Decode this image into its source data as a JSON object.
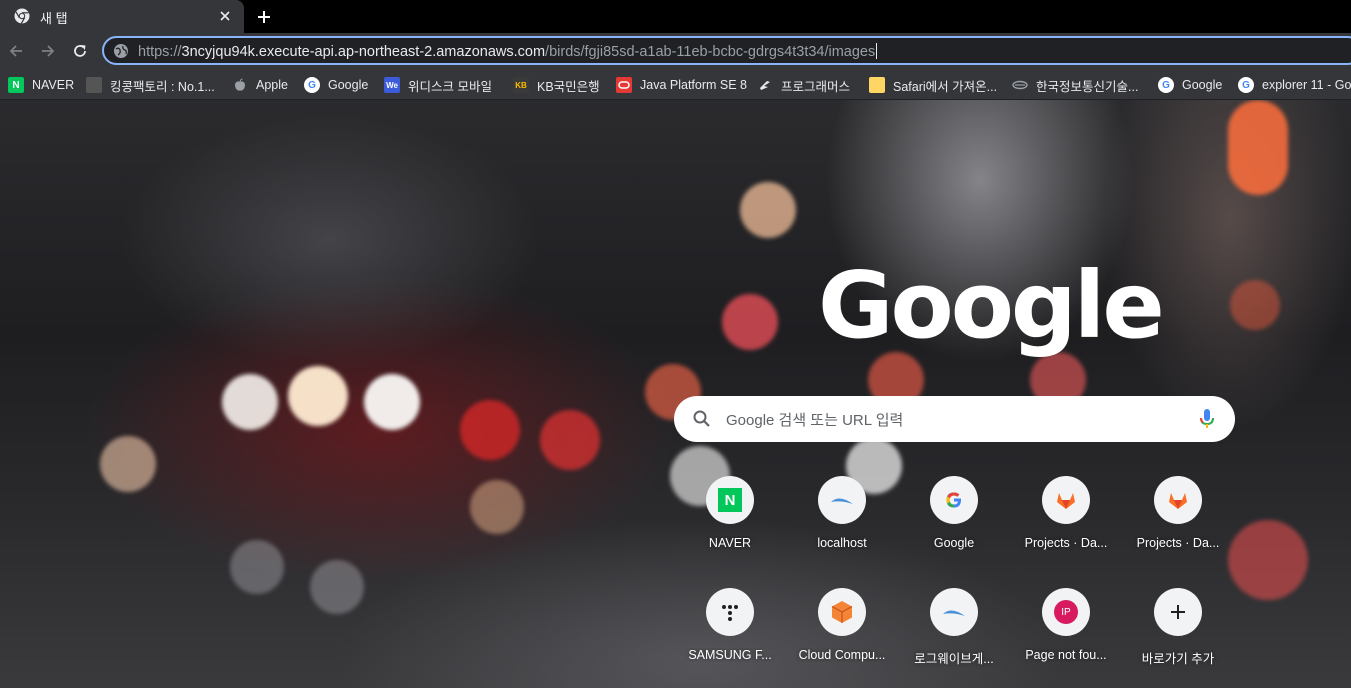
{
  "tab": {
    "title": "새 탭",
    "favicon": "chrome-icon"
  },
  "toolbar": {
    "back_icon": "back-arrow-icon",
    "forward_icon": "forward-arrow-icon",
    "reload_icon": "reload-icon",
    "url_scheme": "https://",
    "url_host": "3ncyjqu94k.execute-api.ap-northeast-2.amazonaws.com",
    "url_path": "/birds/fgji85sd-a1ab-11eb-bcbc-gdrgs4t3t34/images"
  },
  "bookmarks": [
    {
      "label": "NAVER",
      "icon": "naver-icon",
      "color": "#03c75a"
    },
    {
      "label": "킹콩팩토리 : No.1...",
      "icon": "kingkong-icon",
      "color": "#555555"
    },
    {
      "label": "Apple",
      "icon": "apple-icon",
      "color": "#9aa0a6"
    },
    {
      "label": "Google",
      "icon": "google-icon",
      "color": "#ffffff"
    },
    {
      "label": "위디스크 모바일",
      "icon": "wedisk-icon",
      "color": "#3b5bdb"
    },
    {
      "label": "KB국민은행",
      "icon": "kb-icon",
      "color": "#ffbc00"
    },
    {
      "label": "Java Platform SE 8",
      "icon": "oracle-icon",
      "color": "#e53935"
    },
    {
      "label": "프로그래머스",
      "icon": "programmers-icon",
      "color": "#ffffff"
    },
    {
      "label": "Safari에서 가져온...",
      "icon": "folder-icon",
      "color": "#fdd663"
    },
    {
      "label": "한국정보통신기술...",
      "icon": "tta-icon",
      "color": "#9aa0a6"
    },
    {
      "label": "Google",
      "icon": "google-icon",
      "color": "#ffffff"
    },
    {
      "label": "explorer 11 - Go",
      "icon": "google-icon",
      "color": "#ffffff"
    }
  ],
  "ntp": {
    "logo": "Google",
    "search_placeholder": "Google 검색 또는 URL 입력",
    "shortcuts": [
      {
        "label": "NAVER",
        "icon": "naver-icon"
      },
      {
        "label": "localhost",
        "icon": "wave-icon"
      },
      {
        "label": "Google",
        "icon": "google-g-icon"
      },
      {
        "label": "Projects · Da...",
        "icon": "gitlab-icon"
      },
      {
        "label": "Projects · Da...",
        "icon": "gitlab-icon"
      },
      {
        "label": "SAMSUNG F...",
        "icon": "samsung-dots-icon"
      },
      {
        "label": "Cloud Compu...",
        "icon": "aws-cube-icon"
      },
      {
        "label": "로그웨이브게...",
        "icon": "wave-icon"
      },
      {
        "label": "Page not fou...",
        "icon": "ip-badge-icon",
        "badge": "IP"
      },
      {
        "label": "바로가기 추가",
        "icon": "plus-icon"
      }
    ]
  }
}
